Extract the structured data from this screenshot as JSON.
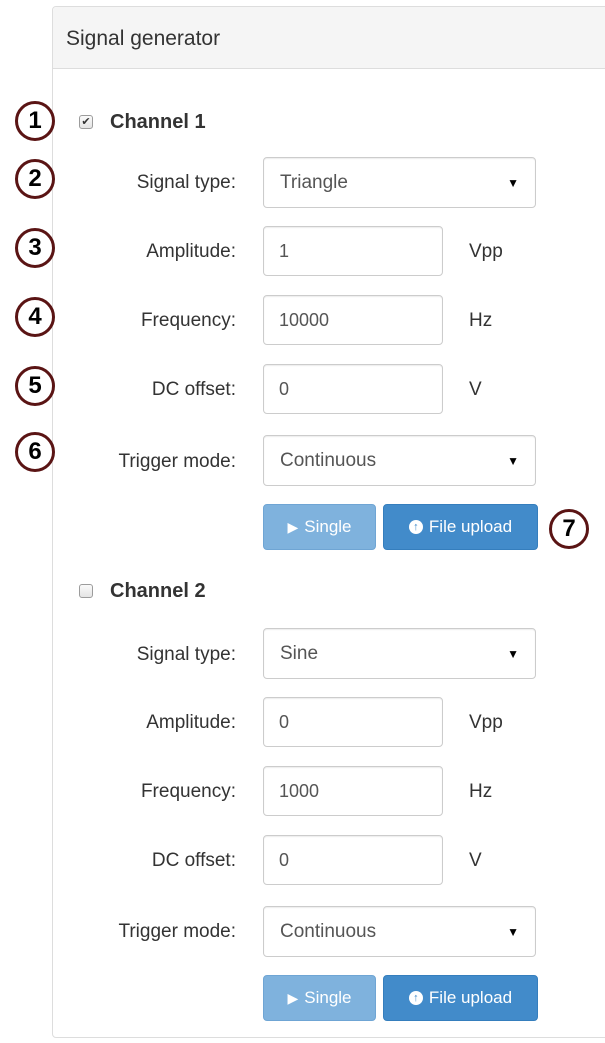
{
  "panel": {
    "title": "Signal generator"
  },
  "callouts": [
    "1",
    "2",
    "3",
    "4",
    "5",
    "6",
    "7"
  ],
  "channels": [
    {
      "label": "Channel 1",
      "checked": true,
      "signal_type_label": "Signal type:",
      "signal_type_value": "Triangle",
      "amplitude_label": "Amplitude:",
      "amplitude_value": "1",
      "amplitude_unit": "Vpp",
      "frequency_label": "Frequency:",
      "frequency_value": "10000",
      "frequency_unit": "Hz",
      "dc_offset_label": "DC offset:",
      "dc_offset_value": "0",
      "dc_offset_unit": "V",
      "trigger_mode_label": "Trigger mode:",
      "trigger_mode_value": "Continuous",
      "single_button": "Single",
      "upload_button": "File upload"
    },
    {
      "label": "Channel 2",
      "checked": false,
      "signal_type_label": "Signal type:",
      "signal_type_value": "Sine",
      "amplitude_label": "Amplitude:",
      "amplitude_value": "0",
      "amplitude_unit": "Vpp",
      "frequency_label": "Frequency:",
      "frequency_value": "1000",
      "frequency_unit": "Hz",
      "dc_offset_label": "DC offset:",
      "dc_offset_value": "0",
      "dc_offset_unit": "V",
      "trigger_mode_label": "Trigger mode:",
      "trigger_mode_value": "Continuous",
      "single_button": "Single",
      "upload_button": "File upload"
    }
  ],
  "icons": {
    "checkbox_checked": "checkmark-icon",
    "select": "caret-down-icon",
    "single": "step-forward-icon",
    "upload": "circle-arrow-up-icon"
  },
  "colors": {
    "primary": "#428bca",
    "primary_disabled": "#7fb2dd",
    "callout_border": "#5a1414",
    "panel_heading_bg": "#f5f5f5"
  }
}
